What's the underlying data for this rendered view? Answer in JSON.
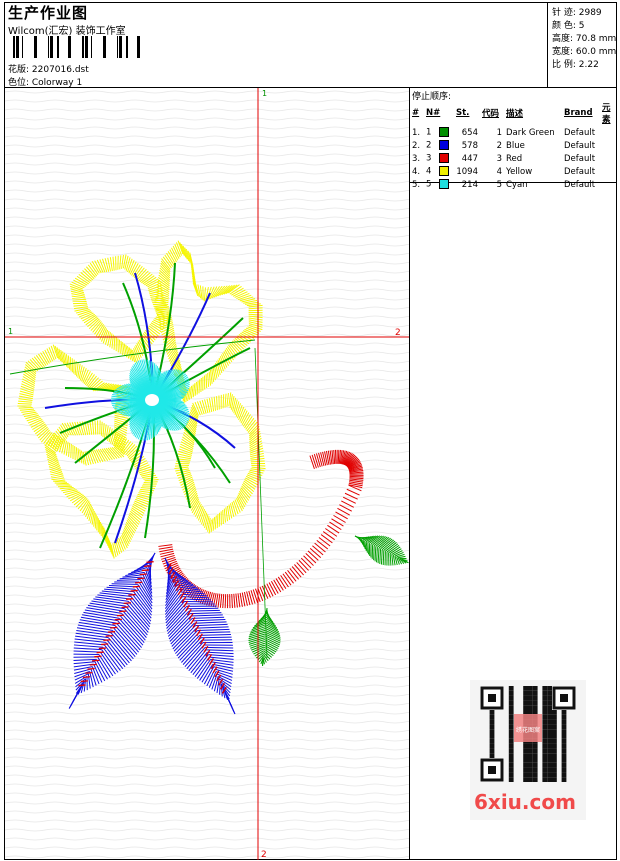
{
  "header": {
    "title": "生产作业图",
    "company": "Wilcom(汇宏) 装饰工作室",
    "design": "花版:  2207016.dst",
    "color_position": "色位:  Colorway 1"
  },
  "info": {
    "stitches": "针 迹:  2989",
    "colors": "颜 色:  5",
    "height": "高度:  70.8 mm",
    "width": "宽度:  60.0 mm",
    "ratio": "比 例:  2.22"
  },
  "sequence": {
    "label": "停止顺序:",
    "columns": [
      "#",
      "N#",
      "St.",
      "代码",
      "描述",
      "Brand",
      "元素"
    ],
    "rows": [
      {
        "idx": "1.",
        "n": "1",
        "color": "#009000",
        "st": "654",
        "code": "1",
        "desc": "Dark Green",
        "brand": "Default"
      },
      {
        "idx": "2.",
        "n": "2",
        "color": "#0000e0",
        "st": "578",
        "code": "2",
        "desc": "Blue",
        "brand": "Default"
      },
      {
        "idx": "3.",
        "n": "3",
        "color": "#e00000",
        "st": "447",
        "code": "3",
        "desc": "Red",
        "brand": "Default"
      },
      {
        "idx": "4.",
        "n": "4",
        "color": "#f0f000",
        "st": "1094",
        "code": "4",
        "desc": "Yellow",
        "brand": "Default"
      },
      {
        "idx": "5.",
        "n": "5",
        "color": "#20e0e0",
        "st": "214",
        "code": "5",
        "desc": "Cyan",
        "brand": "Default"
      }
    ]
  },
  "canvas": {
    "marker_top": "1",
    "marker_left": "1",
    "marker_right": "2",
    "marker_bottom": "2",
    "guide_color": "#e00000"
  },
  "watermark": {
    "text": "6xiu.com",
    "seal": "绣花图案"
  }
}
